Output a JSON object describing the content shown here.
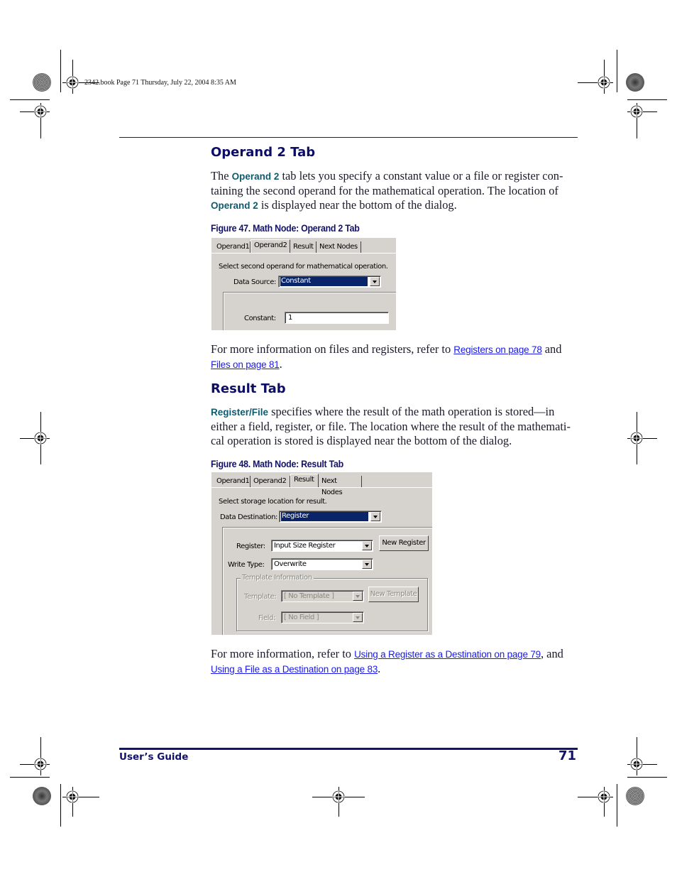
{
  "slug": "2342.book  Page 71  Thursday, July 22, 2004  8:35 AM",
  "section1": {
    "heading": "Operand 2 Tab",
    "para": {
      "pre": "The ",
      "kw1": "Operand 2",
      "mid": " tab lets you specify a constant value or a file or register con-taining the second operand for the mathematical operation. The location of ",
      "kw2": "Operand 2",
      "post": " is displayed near the bottom of the dialog."
    },
    "figure_caption": "Figure 47. Math Node: Operand 2 Tab",
    "dialog": {
      "tabs": [
        "Operand1",
        "Operand2",
        "Result",
        "Next Nodes"
      ],
      "active_tab": "Operand2",
      "instruction": "Select second operand for mathematical operation.",
      "data_source_label": "Data Source:",
      "data_source_value": "Constant",
      "constant_label": "Constant:",
      "constant_value": "1"
    },
    "more_info": {
      "pre": "For more information on files and registers, refer to ",
      "link1": "Registers on page 78",
      "mid": " and ",
      "link2": "Files on page 81",
      "post": "."
    }
  },
  "section2": {
    "heading": "Result Tab",
    "para": {
      "kw": "Register/File",
      "text": " specifies where the result of the math operation is stored—in either a field, register, or file. The location where the result of the mathemati-cal operation is stored is displayed near the bottom of the dialog."
    },
    "figure_caption": "Figure 48. Math Node: Result Tab",
    "dialog": {
      "tabs": [
        "Operand1",
        "Operand2",
        "Result",
        "Next Nodes"
      ],
      "active_tab": "Result",
      "instruction": "Select storage location for result.",
      "data_destination_label": "Data Destination:",
      "data_destination_value": "Register",
      "register_label": "Register:",
      "register_value": "Input Size Register",
      "new_register_button": "New Register",
      "write_type_label": "Write Type:",
      "write_type_value": "Overwrite",
      "template_group_label": "Template Information",
      "template_label": "Template:",
      "template_value": "[ No Template ]",
      "new_template_button": "New Template",
      "field_label": "Field:",
      "field_value": "[ No Field ]"
    },
    "more_info": {
      "pre": "For more information, refer to ",
      "link1": "Using a Register as a Destination on page 79",
      "mid": ", and ",
      "link2": "Using a File as a Destination on page 83",
      "post": "."
    }
  },
  "footer": {
    "title": "User’s Guide",
    "page_number": "71"
  }
}
